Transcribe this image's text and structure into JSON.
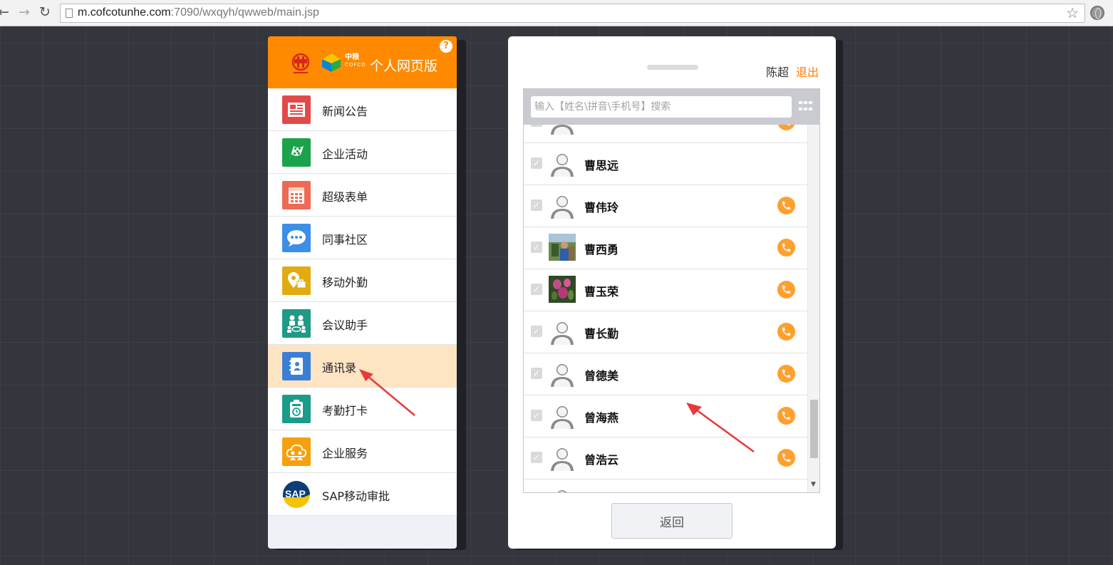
{
  "browser": {
    "url_host": "m.cofcotunhe.com",
    "url_rest": ":7090/wxqyh/qwweb/main.jsp"
  },
  "left_panel": {
    "title": "个人网页版",
    "logo_text": "中粮",
    "logo_subtext": "COFCO",
    "help": "?",
    "menu": [
      {
        "label": "新闻公告",
        "icon": "news-icon",
        "color": "#e24a4a"
      },
      {
        "label": "企业活动",
        "icon": "flag-icon",
        "color": "#1aa34a"
      },
      {
        "label": "超级表单",
        "icon": "form-icon",
        "color": "#ee6a55"
      },
      {
        "label": "同事社区",
        "icon": "chat-icon",
        "color": "#3d8ee8"
      },
      {
        "label": "移动外勤",
        "icon": "location-icon",
        "color": "#e3ab12"
      },
      {
        "label": "会议助手",
        "icon": "meeting-icon",
        "color": "#1e9a85"
      },
      {
        "label": "通讯录",
        "icon": "contacts-icon",
        "color": "#3a7fd6",
        "active": true
      },
      {
        "label": "考勤打卡",
        "icon": "clock-icon",
        "color": "#1b9b8a"
      },
      {
        "label": "企业服务",
        "icon": "service-icon",
        "color": "#f5a00c"
      },
      {
        "label": "SAP移动审批",
        "icon": "sap-icon",
        "color": "#0b3e78"
      }
    ]
  },
  "right_panel": {
    "user_name": "陈超",
    "logout": "退出",
    "search_placeholder": "输入【姓名\\拼音\\手机号】搜索",
    "contacts": [
      {
        "name": "",
        "avatar": "default",
        "call": true,
        "partial": true
      },
      {
        "name": "曹思远",
        "avatar": "default",
        "call": false
      },
      {
        "name": "曹伟玲",
        "avatar": "default",
        "call": true
      },
      {
        "name": "曹西勇",
        "avatar": "photo-outdoor",
        "call": true
      },
      {
        "name": "曹玉荣",
        "avatar": "photo-flower",
        "call": true
      },
      {
        "name": "曹长勤",
        "avatar": "default",
        "call": true
      },
      {
        "name": "曾德美",
        "avatar": "default",
        "call": true
      },
      {
        "name": "曾海燕",
        "avatar": "default",
        "call": true
      },
      {
        "name": "曾浩云",
        "avatar": "default",
        "call": true
      },
      {
        "name": "",
        "avatar": "default",
        "call": false,
        "partial": true
      }
    ],
    "back_label": "返回"
  },
  "colors": {
    "accent": "#ff8a00",
    "active_row": "#fde5c4",
    "call": "#ffa02e",
    "annotation_arrow": "#e83a3a"
  }
}
